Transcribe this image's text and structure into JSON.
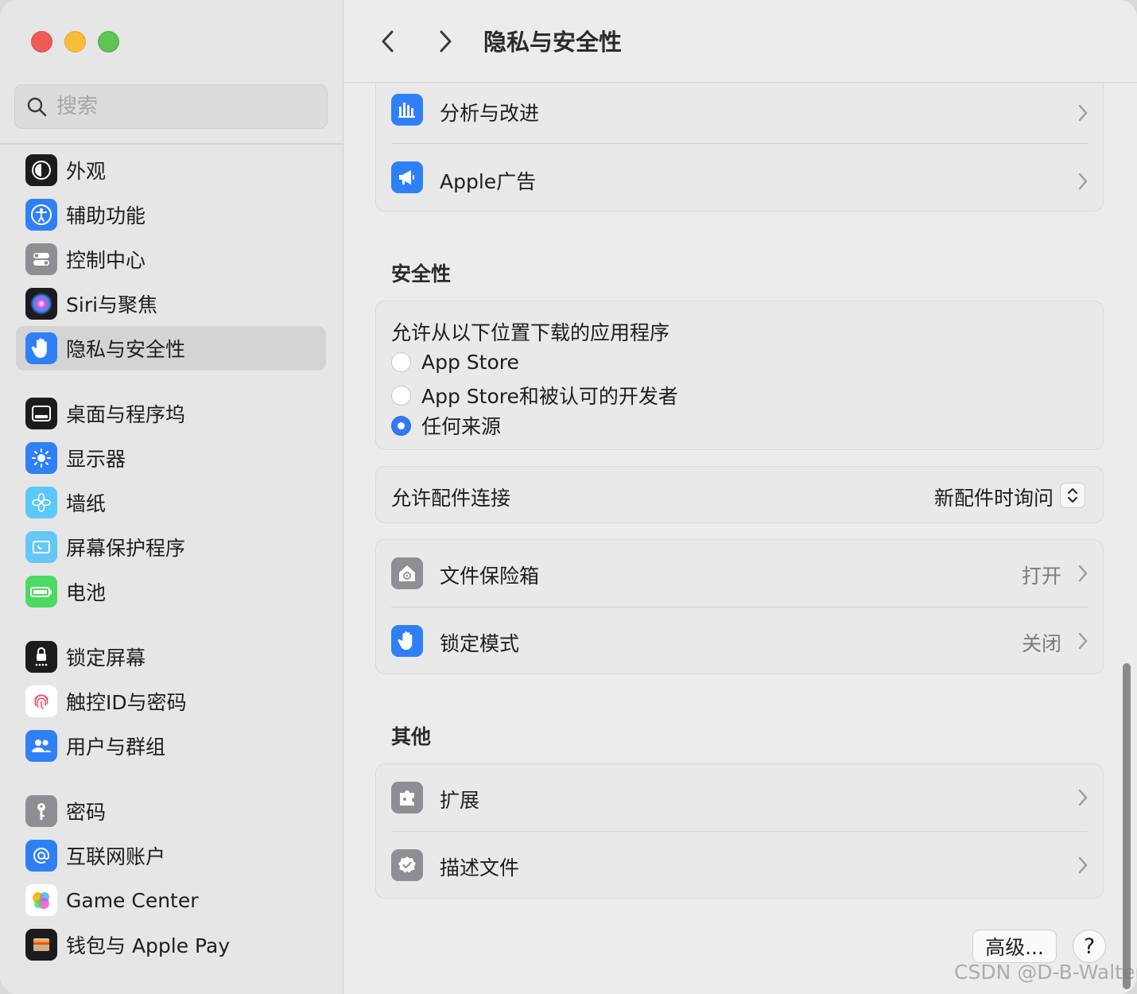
{
  "search": {
    "placeholder": "搜索"
  },
  "sidebar": {
    "items": [
      {
        "label": "外观"
      },
      {
        "label": "辅助功能"
      },
      {
        "label": "控制中心"
      },
      {
        "label": "Siri与聚焦"
      },
      {
        "label": "隐私与安全性"
      },
      {
        "label": "桌面与程序坞"
      },
      {
        "label": "显示器"
      },
      {
        "label": "墙纸"
      },
      {
        "label": "屏幕保护程序"
      },
      {
        "label": "电池"
      },
      {
        "label": "锁定屏幕"
      },
      {
        "label": "触控ID与密码"
      },
      {
        "label": "用户与群组"
      },
      {
        "label": "密码"
      },
      {
        "label": "互联网账户"
      },
      {
        "label": "Game Center"
      },
      {
        "label": "钱包与 Apple Pay"
      }
    ]
  },
  "header": {
    "title": "隐私与安全性"
  },
  "privacy": {
    "analytics": "分析与改进",
    "ads": "Apple广告"
  },
  "security": {
    "title": "安全性",
    "download_heading": "允许从以下位置下载的应用程序",
    "options": [
      "App Store",
      "App Store和被认可的开发者",
      "任何来源"
    ],
    "selected_option": "任何来源",
    "accessory_label": "允许配件连接",
    "accessory_value": "新配件时询问",
    "filevault_label": "文件保险箱",
    "filevault_value": "打开",
    "lockdown_label": "锁定模式",
    "lockdown_value": "关闭"
  },
  "other": {
    "title": "其他",
    "extensions": "扩展",
    "profiles": "描述文件"
  },
  "footer": {
    "advanced": "高级...",
    "help": "?"
  },
  "watermark": "CSDN @D-B-Walter",
  "colors": {
    "accent": "#3478f6",
    "selected_sidebar": "#d4d4d4"
  }
}
